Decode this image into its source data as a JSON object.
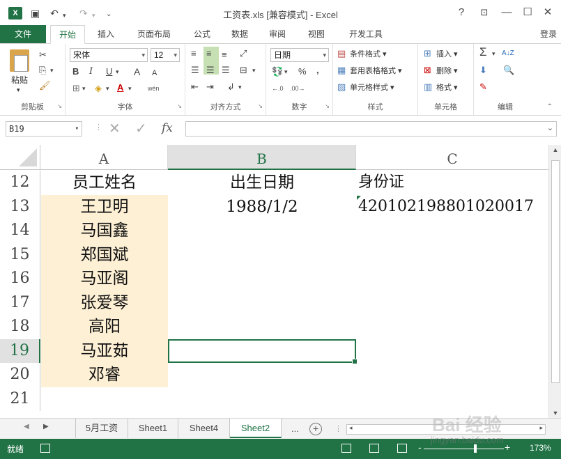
{
  "window": {
    "title": "工资表.xls  [兼容模式] - Excel",
    "app_badge": "X",
    "help": "?",
    "controls": [
      "⊡",
      "—",
      "☐",
      "✕"
    ]
  },
  "quick_access": {
    "undo": "↶",
    "redo": "↷",
    "customize": "⌄"
  },
  "menu": {
    "file": "文件",
    "tabs": [
      "开始",
      "插入",
      "页面布局",
      "公式",
      "数据",
      "审阅",
      "视图",
      "开发工具"
    ],
    "active_tab": "开始",
    "login": "登录"
  },
  "ribbon": {
    "clipboard": {
      "label": "剪贴板",
      "paste": "粘贴"
    },
    "font": {
      "label": "字体",
      "name": "宋体",
      "size": "12",
      "bold": "B",
      "italic": "I",
      "underline": "U",
      "grow": "A",
      "shrink": "A",
      "wen": "wén"
    },
    "alignment": {
      "label": "对齐方式"
    },
    "number": {
      "label": "数字",
      "format": "日期",
      "percent": "%",
      "comma": ","
    },
    "styles": {
      "label": "样式",
      "conditional": "条件格式",
      "table": "套用表格格式",
      "cell_styles": "单元格样式"
    },
    "cells": {
      "label": "单元格",
      "insert": "插入",
      "delete": "删除",
      "format": "格式"
    },
    "editing": {
      "label": "编辑",
      "sum": "Σ",
      "sort": "A↓Z",
      "find": "🔍"
    }
  },
  "formula_bar": {
    "name_box": "B19",
    "fx": "fx",
    "content": ""
  },
  "sheet": {
    "columns": [
      "A",
      "B",
      "C"
    ],
    "selected_column": "B",
    "rows": [
      {
        "num": "12",
        "A": "员工姓名",
        "B": "出生日期",
        "C": "身份证"
      },
      {
        "num": "13",
        "A": "王卫明",
        "B": "1988/1/2",
        "C": "420102198801020017"
      },
      {
        "num": "14",
        "A": "马国鑫",
        "B": "",
        "C": ""
      },
      {
        "num": "15",
        "A": "郑国斌",
        "B": "",
        "C": ""
      },
      {
        "num": "16",
        "A": "马亚阁",
        "B": "",
        "C": ""
      },
      {
        "num": "17",
        "A": "张爱琴",
        "B": "",
        "C": ""
      },
      {
        "num": "18",
        "A": "高阳",
        "B": "",
        "C": ""
      },
      {
        "num": "19",
        "A": "马亚茹",
        "B": "",
        "C": ""
      },
      {
        "num": "20",
        "A": "邓睿",
        "B": "",
        "C": ""
      },
      {
        "num": "21",
        "A": "",
        "B": "",
        "C": ""
      }
    ],
    "selected_row": "19",
    "active_cell": "B19",
    "fill_color": "#fdf0d5"
  },
  "sheet_tabs": {
    "tabs": [
      "5月工资",
      "Sheet1",
      "Sheet4",
      "Sheet2"
    ],
    "active": "Sheet2",
    "more": "...",
    "add": "+"
  },
  "status": {
    "ready": "就绪",
    "zoom_minus": "-",
    "zoom_plus": "+",
    "zoom": "173%"
  },
  "watermark": {
    "brand": "Bai 经验",
    "url": "jingyan.baidu.com"
  },
  "colors": {
    "accent": "#217346",
    "fill": "#fdf0d5",
    "header_sel": "#e1e1e1"
  }
}
